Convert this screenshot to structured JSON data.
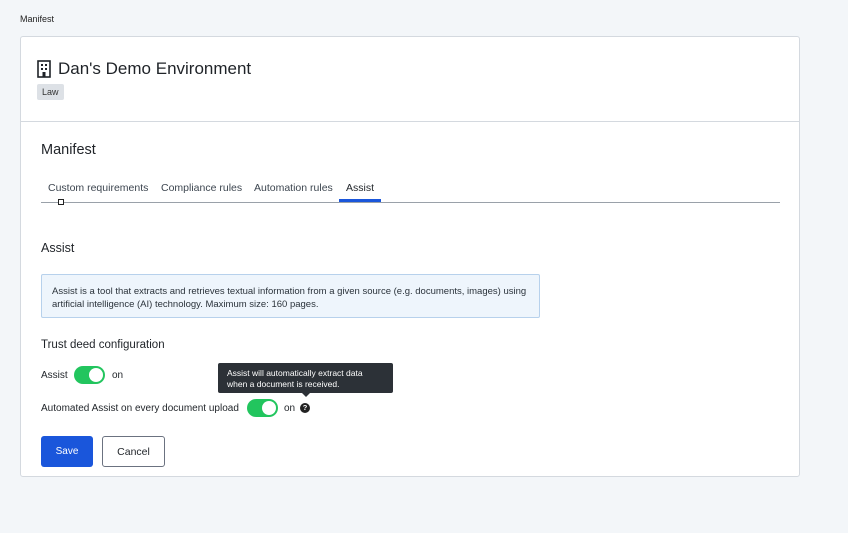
{
  "breadcrumb": "Manifest",
  "environment": {
    "title": "Dan's Demo Environment",
    "tag": "Law",
    "icon": "building-icon"
  },
  "section_title": "Manifest",
  "tabs": [
    {
      "label": "Custom requirements",
      "active": false
    },
    {
      "label": "Compliance rules",
      "active": false
    },
    {
      "label": "Automation rules",
      "active": false
    },
    {
      "label": "Assist",
      "active": true
    }
  ],
  "assist": {
    "heading": "Assist",
    "info_line1": "Assist is a tool that extracts and retrieves textual information from a given source (e.g. documents, images) using",
    "info_line2": "artificial intelligence (AI) technology. Maximum size: 160 pages."
  },
  "trust_deed": {
    "heading": "Trust deed configuration",
    "assist_label": "Assist",
    "assist_state": "on",
    "auto_label": "Automated Assist on every document upload",
    "auto_state": "on",
    "help_icon": "question-icon"
  },
  "tooltip": {
    "line1": "Assist will automatically extract data",
    "line2": "when a document is received."
  },
  "actions": {
    "save_label": "Save",
    "cancel_label": "Cancel"
  },
  "colors": {
    "primary": "#1a56db",
    "toggle_on": "#22c55e",
    "info_bg": "#eef5fc",
    "tooltip_bg": "#2c3137"
  }
}
